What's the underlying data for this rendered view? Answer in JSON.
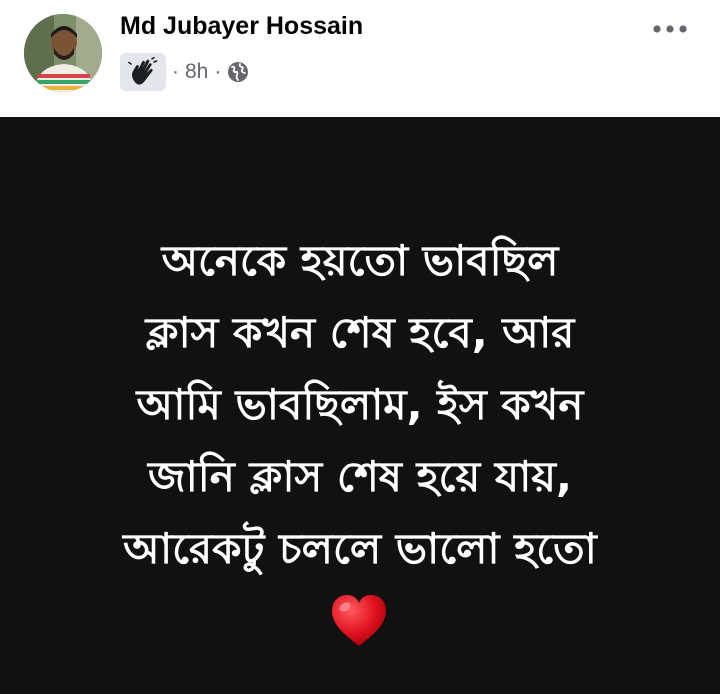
{
  "post": {
    "author_name": "Md Jubayer Hossain",
    "time": "8h",
    "separator": "·",
    "badge_icon": "waving-hand-icon",
    "audience_icon": "globe-icon",
    "more_icon": "more-options-icon",
    "text_lines": [
      "অনেকে হয়তো ভাবছিল",
      "ক্লাস কখন শেষ হবে, আর",
      "আমি ভাবছিলাম, ইস কখন",
      "জানি ক্লাস শেষ হয়ে যায়,",
      "আরেকটু চললে ভালো হতো"
    ],
    "emoji": "❤️",
    "colors": {
      "background": "#111111",
      "text": "#ffffff",
      "meta": "#65676b",
      "heart": "#e0121f"
    }
  }
}
